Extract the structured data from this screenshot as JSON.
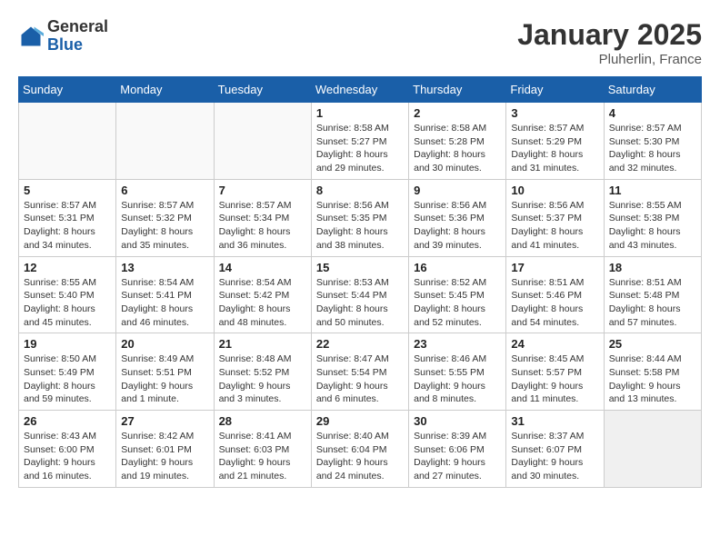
{
  "header": {
    "logo_general": "General",
    "logo_blue": "Blue",
    "title": "January 2025",
    "subtitle": "Pluherlin, France"
  },
  "days_of_week": [
    "Sunday",
    "Monday",
    "Tuesday",
    "Wednesday",
    "Thursday",
    "Friday",
    "Saturday"
  ],
  "weeks": [
    [
      {
        "day": "",
        "detail": ""
      },
      {
        "day": "",
        "detail": ""
      },
      {
        "day": "",
        "detail": ""
      },
      {
        "day": "1",
        "detail": "Sunrise: 8:58 AM\nSunset: 5:27 PM\nDaylight: 8 hours and 29 minutes."
      },
      {
        "day": "2",
        "detail": "Sunrise: 8:58 AM\nSunset: 5:28 PM\nDaylight: 8 hours and 30 minutes."
      },
      {
        "day": "3",
        "detail": "Sunrise: 8:57 AM\nSunset: 5:29 PM\nDaylight: 8 hours and 31 minutes."
      },
      {
        "day": "4",
        "detail": "Sunrise: 8:57 AM\nSunset: 5:30 PM\nDaylight: 8 hours and 32 minutes."
      }
    ],
    [
      {
        "day": "5",
        "detail": "Sunrise: 8:57 AM\nSunset: 5:31 PM\nDaylight: 8 hours and 34 minutes."
      },
      {
        "day": "6",
        "detail": "Sunrise: 8:57 AM\nSunset: 5:32 PM\nDaylight: 8 hours and 35 minutes."
      },
      {
        "day": "7",
        "detail": "Sunrise: 8:57 AM\nSunset: 5:34 PM\nDaylight: 8 hours and 36 minutes."
      },
      {
        "day": "8",
        "detail": "Sunrise: 8:56 AM\nSunset: 5:35 PM\nDaylight: 8 hours and 38 minutes."
      },
      {
        "day": "9",
        "detail": "Sunrise: 8:56 AM\nSunset: 5:36 PM\nDaylight: 8 hours and 39 minutes."
      },
      {
        "day": "10",
        "detail": "Sunrise: 8:56 AM\nSunset: 5:37 PM\nDaylight: 8 hours and 41 minutes."
      },
      {
        "day": "11",
        "detail": "Sunrise: 8:55 AM\nSunset: 5:38 PM\nDaylight: 8 hours and 43 minutes."
      }
    ],
    [
      {
        "day": "12",
        "detail": "Sunrise: 8:55 AM\nSunset: 5:40 PM\nDaylight: 8 hours and 45 minutes."
      },
      {
        "day": "13",
        "detail": "Sunrise: 8:54 AM\nSunset: 5:41 PM\nDaylight: 8 hours and 46 minutes."
      },
      {
        "day": "14",
        "detail": "Sunrise: 8:54 AM\nSunset: 5:42 PM\nDaylight: 8 hours and 48 minutes."
      },
      {
        "day": "15",
        "detail": "Sunrise: 8:53 AM\nSunset: 5:44 PM\nDaylight: 8 hours and 50 minutes."
      },
      {
        "day": "16",
        "detail": "Sunrise: 8:52 AM\nSunset: 5:45 PM\nDaylight: 8 hours and 52 minutes."
      },
      {
        "day": "17",
        "detail": "Sunrise: 8:51 AM\nSunset: 5:46 PM\nDaylight: 8 hours and 54 minutes."
      },
      {
        "day": "18",
        "detail": "Sunrise: 8:51 AM\nSunset: 5:48 PM\nDaylight: 8 hours and 57 minutes."
      }
    ],
    [
      {
        "day": "19",
        "detail": "Sunrise: 8:50 AM\nSunset: 5:49 PM\nDaylight: 8 hours and 59 minutes."
      },
      {
        "day": "20",
        "detail": "Sunrise: 8:49 AM\nSunset: 5:51 PM\nDaylight: 9 hours and 1 minute."
      },
      {
        "day": "21",
        "detail": "Sunrise: 8:48 AM\nSunset: 5:52 PM\nDaylight: 9 hours and 3 minutes."
      },
      {
        "day": "22",
        "detail": "Sunrise: 8:47 AM\nSunset: 5:54 PM\nDaylight: 9 hours and 6 minutes."
      },
      {
        "day": "23",
        "detail": "Sunrise: 8:46 AM\nSunset: 5:55 PM\nDaylight: 9 hours and 8 minutes."
      },
      {
        "day": "24",
        "detail": "Sunrise: 8:45 AM\nSunset: 5:57 PM\nDaylight: 9 hours and 11 minutes."
      },
      {
        "day": "25",
        "detail": "Sunrise: 8:44 AM\nSunset: 5:58 PM\nDaylight: 9 hours and 13 minutes."
      }
    ],
    [
      {
        "day": "26",
        "detail": "Sunrise: 8:43 AM\nSunset: 6:00 PM\nDaylight: 9 hours and 16 minutes."
      },
      {
        "day": "27",
        "detail": "Sunrise: 8:42 AM\nSunset: 6:01 PM\nDaylight: 9 hours and 19 minutes."
      },
      {
        "day": "28",
        "detail": "Sunrise: 8:41 AM\nSunset: 6:03 PM\nDaylight: 9 hours and 21 minutes."
      },
      {
        "day": "29",
        "detail": "Sunrise: 8:40 AM\nSunset: 6:04 PM\nDaylight: 9 hours and 24 minutes."
      },
      {
        "day": "30",
        "detail": "Sunrise: 8:39 AM\nSunset: 6:06 PM\nDaylight: 9 hours and 27 minutes."
      },
      {
        "day": "31",
        "detail": "Sunrise: 8:37 AM\nSunset: 6:07 PM\nDaylight: 9 hours and 30 minutes."
      },
      {
        "day": "",
        "detail": ""
      }
    ]
  ]
}
